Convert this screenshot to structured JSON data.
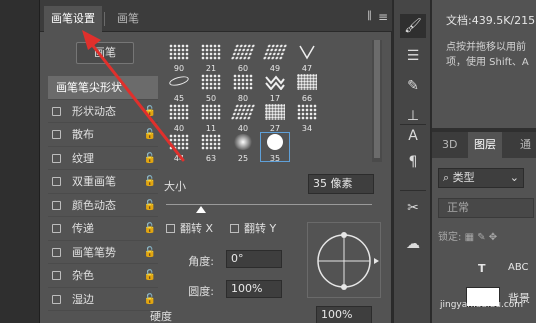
{
  "brush_panel": {
    "tabs": [
      {
        "label": "画笔设置",
        "active": true
      },
      {
        "label": "画笔",
        "active": false
      }
    ],
    "collapse_icon": "double-chevron-icon",
    "menu_icon": "hamburger-menu-icon",
    "brush_button_label": "画笔",
    "options": [
      {
        "label": "画笔笔尖形状",
        "header": true
      },
      {
        "label": "形状动态",
        "checked": false
      },
      {
        "label": "散布",
        "checked": false
      },
      {
        "label": "纹理",
        "checked": false
      },
      {
        "label": "双重画笔",
        "checked": false
      },
      {
        "label": "颜色动态",
        "checked": false
      },
      {
        "label": "传递",
        "checked": false
      },
      {
        "label": "画笔笔势",
        "checked": false
      },
      {
        "label": "杂色",
        "checked": false
      },
      {
        "label": "湿边",
        "checked": false
      }
    ],
    "presets": [
      "90",
      "21",
      "60",
      "49",
      "47",
      "45",
      "50",
      "80",
      "17",
      "66",
      "40",
      "11",
      "40",
      "27",
      "34",
      "44",
      "63",
      "25",
      "35"
    ],
    "selected_preset_index": 18,
    "size_label": "大小",
    "size_value": "35 像素",
    "flip_x_label": "翻转 X",
    "flip_y_label": "翻转 Y",
    "angle_label": "角度:",
    "angle_value": "0°",
    "roundness_label": "圆度:",
    "roundness_value": "100%",
    "hardness_label": "硬度",
    "hardness_value": "100%"
  },
  "toolbar": {
    "icons": [
      "brush-icon",
      "sliders-icon",
      "brush-preset-icon",
      "stamp-icon",
      "type-icon",
      "paragraph-icon",
      "scissors-icon",
      "cloud-icon"
    ]
  },
  "right_panel": {
    "doc_info": "文档:439.5K/215.",
    "hint_line1": "点按并拖移以用前",
    "hint_line2": "项，使用 Shift、A",
    "tabs": [
      {
        "label": "3D",
        "active": false
      },
      {
        "label": "图层",
        "active": true
      },
      {
        "label": "通",
        "active": false
      }
    ],
    "kind_label": "类型",
    "blend_mode": "正常",
    "lock_label": "锁定:",
    "layer_name": "背景"
  },
  "watermark": "jingyan.baidu.com",
  "colors": {
    "annotation_arrow": "#e0302c",
    "panel_bg": "#535353",
    "selection": "#5fa0d8"
  }
}
